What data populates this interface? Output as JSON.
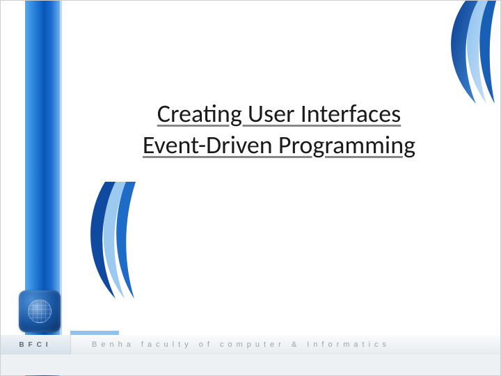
{
  "title": {
    "line1": "Creating User Interfaces",
    "line2": "Event-Driven Programming"
  },
  "footer": {
    "abbr": "BFCI",
    "text": "Benha  faculty  of  computer  &  Informatics"
  },
  "colors": {
    "sidebar_blue": "#247dd8",
    "accent_light": "#8fc2ef",
    "logo_deep": "#0b2f63"
  }
}
